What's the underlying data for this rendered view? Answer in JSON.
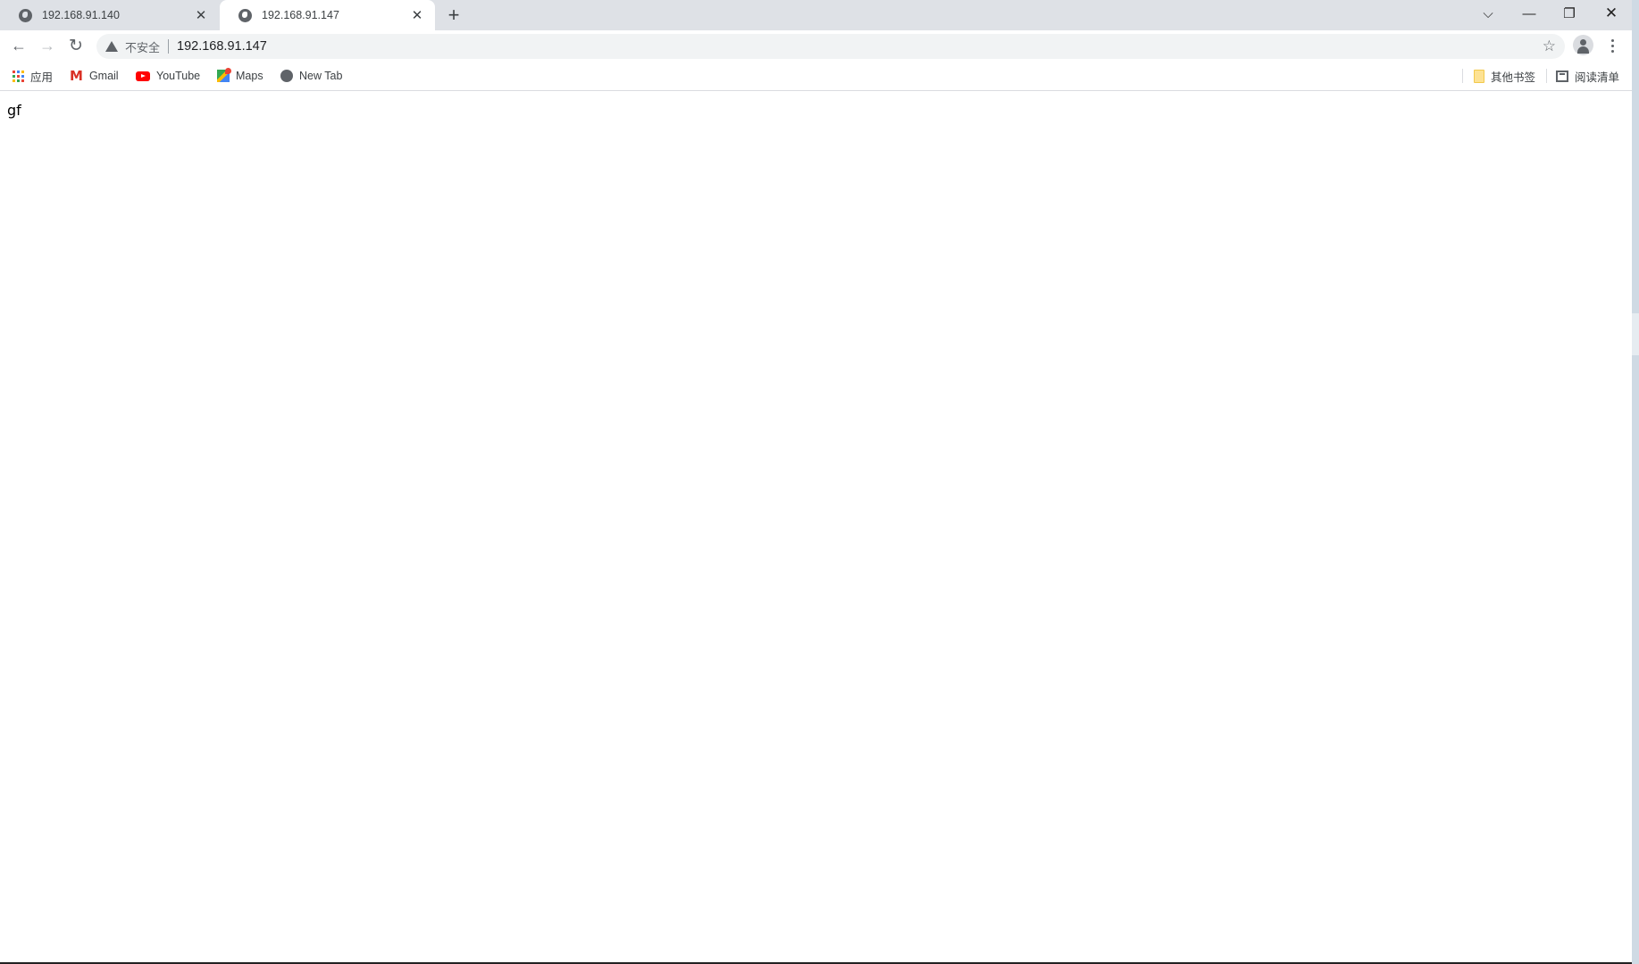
{
  "tabs": [
    {
      "title": "192.168.91.140",
      "active": false,
      "icon": "globe-icon"
    },
    {
      "title": "192.168.91.147",
      "active": true,
      "icon": "globe-icon"
    }
  ],
  "tab_close_glyph": "✕",
  "new_tab_glyph": "+",
  "window_controls": {
    "tab_search": "⌵",
    "minimize": "—",
    "restore": "❐",
    "close": "✕"
  },
  "toolbar": {
    "back": "←",
    "forward": "→",
    "reload": "↻",
    "security_label": "不安全",
    "url": "192.168.91.147",
    "star": "☆"
  },
  "bookmarks": [
    {
      "label": "应用",
      "icon": "apps-icon"
    },
    {
      "label": "Gmail",
      "icon": "gmail-icon"
    },
    {
      "label": "YouTube",
      "icon": "youtube-icon"
    },
    {
      "label": "Maps",
      "icon": "maps-icon"
    },
    {
      "label": "New Tab",
      "icon": "globe-icon"
    }
  ],
  "other_bookmarks": "其他书签",
  "reading_list": "阅读清单",
  "page": {
    "text": "gf"
  },
  "colors": {
    "tabbar": "#dee1e6",
    "omnibox": "#f1f3f4",
    "icon": "#5f6368"
  }
}
